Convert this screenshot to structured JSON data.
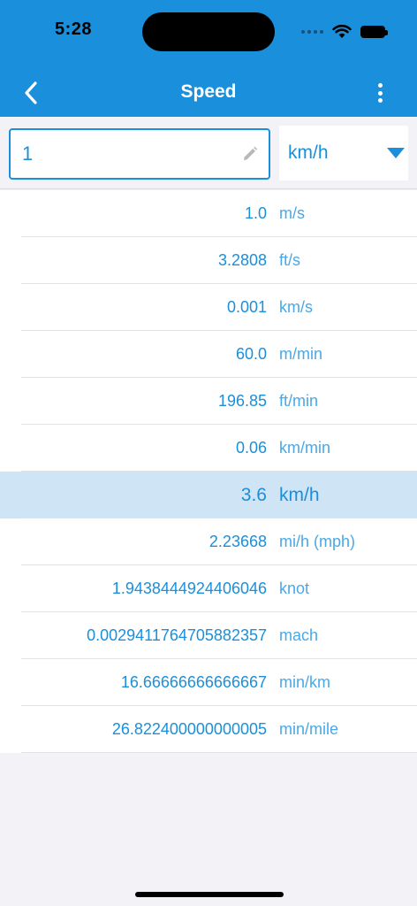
{
  "status": {
    "time": "5:28"
  },
  "header": {
    "title": "Speed"
  },
  "input": {
    "value": "1",
    "unit_selected": "km/h"
  },
  "results": [
    {
      "value": "1.0",
      "unit": "m/s"
    },
    {
      "value": "3.2808",
      "unit": "ft/s"
    },
    {
      "value": "0.001",
      "unit": "km/s"
    },
    {
      "value": "60.0",
      "unit": "m/min"
    },
    {
      "value": "196.85",
      "unit": "ft/min"
    },
    {
      "value": "0.06",
      "unit": "km/min"
    },
    {
      "value": "3.6",
      "unit": "km/h",
      "selected": true
    },
    {
      "value": "2.23668",
      "unit": "mi/h (mph)"
    },
    {
      "value": "1.9438444924406046",
      "unit": "knot"
    },
    {
      "value": "0.002941176470588235​7",
      "unit": "mach"
    },
    {
      "value": "16.66666666666667",
      "unit": "min/km"
    },
    {
      "value": "26.822400000000005",
      "unit": "min/mile"
    }
  ],
  "colors": {
    "accent": "#1a8fdc",
    "selected_row": "#cfe4f5",
    "background": "#f2f2f7"
  },
  "icons": {
    "back": "chevron-left-icon",
    "menu": "more-vertical-icon",
    "edit": "pencil-icon",
    "dropdown": "caret-down-icon"
  }
}
